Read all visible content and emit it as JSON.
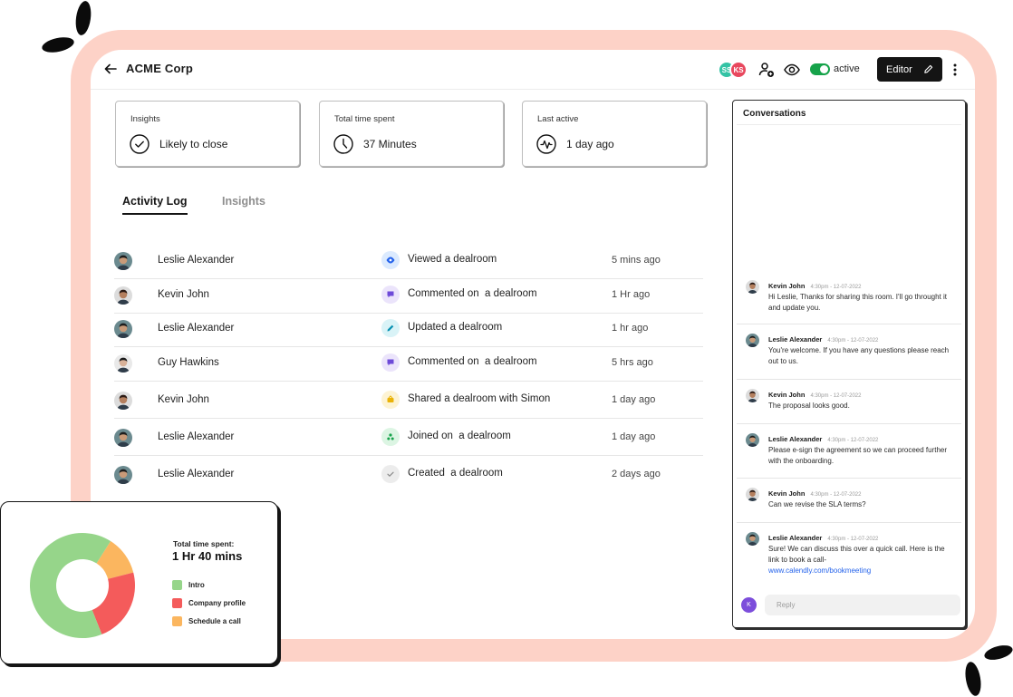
{
  "app": {
    "title": "ACME Corp",
    "status_label": "active",
    "editor_label": "Editor",
    "collaborators": [
      {
        "initials": "SS",
        "color": "#34c3a5"
      },
      {
        "initials": "KS",
        "color": "#e8485e"
      }
    ],
    "icons": [
      "back-arrow-icon",
      "add-user-icon",
      "eye-icon",
      "toggle-switch",
      "pencil-icon",
      "kebab-menu-icon"
    ]
  },
  "stats": [
    {
      "label": "Insights",
      "value": "Likely to close",
      "icon": "check-circle-icon"
    },
    {
      "label": "Total time spent",
      "value": "37 Minutes",
      "icon": "clock-icon"
    },
    {
      "label": "Last active",
      "value": "1 day ago",
      "icon": "pulse-icon"
    }
  ],
  "tabs": [
    {
      "label": "Activity Log",
      "active": true
    },
    {
      "label": "Insights",
      "active": false
    }
  ],
  "activity": [
    {
      "name": "Leslie Alexander",
      "action": "Viewed a dealroom",
      "time": "5 mins ago",
      "icon": "eye-icon",
      "icon_color": "#2563eb",
      "icon_bg": "#dbeafe"
    },
    {
      "name": "Kevin John",
      "action": "Commented on  a dealroom",
      "time": "1 Hr ago",
      "icon": "comment-icon",
      "icon_color": "#6d4ad8",
      "icon_bg": "#ebe4fb"
    },
    {
      "name": "Leslie Alexander",
      "action": "Updated a dealroom",
      "time": "1 hr ago",
      "icon": "pencil-icon",
      "icon_color": "#0891b2",
      "icon_bg": "#d9f3f7"
    },
    {
      "name": "Guy Hawkins",
      "action": "Commented on  a dealroom",
      "time": "5 hrs ago",
      "icon": "comment-icon",
      "icon_color": "#6d4ad8",
      "icon_bg": "#ebe4fb"
    },
    {
      "name": "Kevin John",
      "action": "Shared a dealroom with Simon",
      "time": "1 day ago",
      "icon": "share-icon",
      "icon_color": "#eab308",
      "icon_bg": "#fdf3d3"
    },
    {
      "name": "Leslie Alexander",
      "action": "Joined on  a dealroom",
      "time": "1 day ago",
      "icon": "join-icon",
      "icon_color": "#16a34a",
      "icon_bg": "#dcf5e3"
    },
    {
      "name": "Leslie Alexander",
      "action": "Created  a dealroom",
      "time": "2 days ago",
      "icon": "check-icon",
      "icon_color": "#8a8a8a",
      "icon_bg": "#ececec"
    }
  ],
  "conversations": {
    "title": "Conversations",
    "messages": [
      {
        "author": "Kevin John",
        "time": "4:30pm - 12-07-2022",
        "text": "Hi Leslie, Thanks for sharing this room. I'll go throught it and update you.",
        "link": ""
      },
      {
        "author": "Leslie Alexander",
        "time": "4:30pm - 12-07-2022",
        "text": "You're welcome. If you have any questions please reach out to us.",
        "link": ""
      },
      {
        "author": "Kevin John",
        "time": "4:30pm - 12-07-2022",
        "text": "The proposal looks good.",
        "link": ""
      },
      {
        "author": "Leslie Alexander",
        "time": "4:30pm - 12-07-2022",
        "text": "Please e-sign the agreement so we can proceed further with the onboarding.",
        "link": ""
      },
      {
        "author": "Kevin John",
        "time": "4:30pm - 12-07-2022",
        "text": "Can we revise the SLA terms?",
        "link": ""
      },
      {
        "author": "Leslie Alexander",
        "time": "4:30pm - 12-07-2022",
        "text": "Sure! We can discuss this over a quick call. Here is the link to book a call-",
        "link": "www.calendly.com/bookmeeting"
      }
    ],
    "reply_avatar": "K",
    "reply_placeholder": "Reply"
  },
  "time_card": {
    "label": "Total time spent:",
    "total": "1 Hr 40 mins"
  },
  "chart_data": {
    "type": "pie",
    "title": "",
    "donut": true,
    "categories": [
      "Intro",
      "Company profile",
      "Schedule a call"
    ],
    "values": [
      65,
      23,
      12
    ],
    "colors": [
      "#96d58a",
      "#f45b5b",
      "#fbb65f"
    ]
  }
}
